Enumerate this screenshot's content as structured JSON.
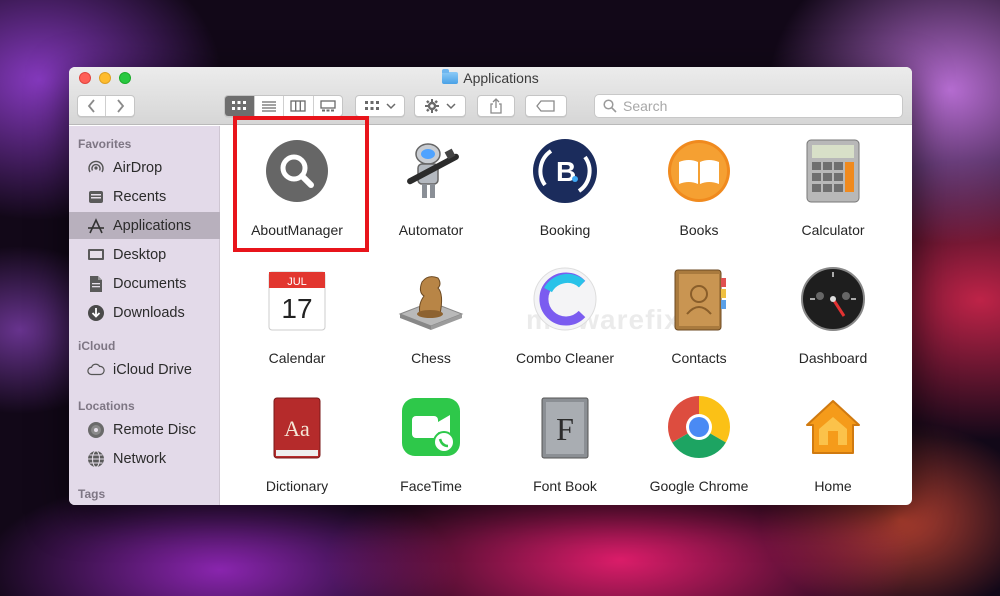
{
  "window": {
    "title": "Applications"
  },
  "toolbar": {
    "search_placeholder": "Search"
  },
  "sidebar": {
    "sections": [
      {
        "label": "Favorites"
      },
      {
        "label": "iCloud"
      },
      {
        "label": "Locations"
      },
      {
        "label": "Tags"
      }
    ],
    "favorites": [
      {
        "label": "AirDrop",
        "icon": "airdrop-icon"
      },
      {
        "label": "Recents",
        "icon": "recents-icon"
      },
      {
        "label": "Applications",
        "icon": "applications-icon",
        "selected": true
      },
      {
        "label": "Desktop",
        "icon": "desktop-icon"
      },
      {
        "label": "Documents",
        "icon": "documents-icon"
      },
      {
        "label": "Downloads",
        "icon": "downloads-icon"
      }
    ],
    "icloud": [
      {
        "label": "iCloud Drive",
        "icon": "cloud-icon"
      }
    ],
    "locations": [
      {
        "label": "Remote Disc",
        "icon": "disc-icon"
      },
      {
        "label": "Network",
        "icon": "network-icon"
      }
    ]
  },
  "apps": [
    {
      "label": "AboutManager",
      "icon": "magnifier-app-icon",
      "highlighted": true
    },
    {
      "label": "Automator",
      "icon": "robot-icon"
    },
    {
      "label": "Booking",
      "icon": "booking-icon"
    },
    {
      "label": "Books",
      "icon": "books-icon"
    },
    {
      "label": "Calculator",
      "icon": "calculator-icon"
    },
    {
      "label": "Calendar",
      "icon": "calendar-icon",
      "month": "JUL",
      "day": "17"
    },
    {
      "label": "Chess",
      "icon": "chess-icon"
    },
    {
      "label": "Combo Cleaner",
      "icon": "combo-cleaner-icon"
    },
    {
      "label": "Contacts",
      "icon": "contacts-icon"
    },
    {
      "label": "Dashboard",
      "icon": "dashboard-icon"
    },
    {
      "label": "Dictionary",
      "icon": "dictionary-icon",
      "glyph": "Aa"
    },
    {
      "label": "FaceTime",
      "icon": "facetime-icon"
    },
    {
      "label": "Font Book",
      "icon": "font-book-icon",
      "glyph": "F"
    },
    {
      "label": "Google Chrome",
      "icon": "chrome-icon"
    },
    {
      "label": "Home",
      "icon": "home-icon"
    }
  ],
  "watermark": "malwarefixes",
  "colors": {
    "highlight": "#e8141b",
    "selected_sidebar": "#b8b0bd"
  }
}
